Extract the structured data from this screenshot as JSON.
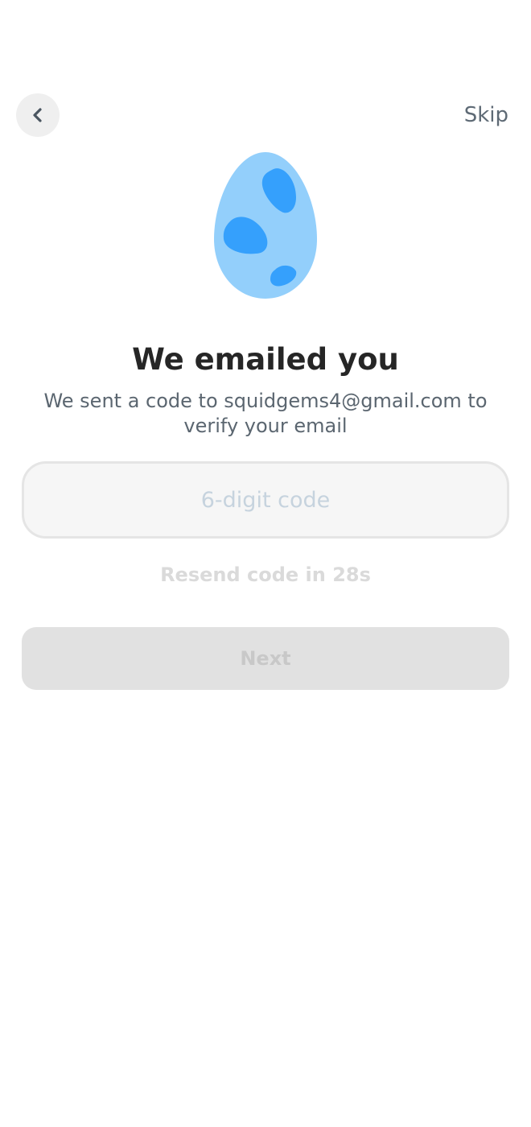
{
  "header": {
    "back_icon": "chevron-left-icon",
    "skip_label": "Skip"
  },
  "illustration": {
    "name": "egg",
    "colors": {
      "shell": "#93cffb",
      "spots": "#35a0fc"
    }
  },
  "main": {
    "title": "We emailed you",
    "subtitle": "We sent a code to squidgems4@gmail.com to verify your email",
    "code_input": {
      "value": "",
      "placeholder": "6-digit code"
    },
    "resend_text": "Resend code in 28s",
    "next_label": "Next"
  },
  "colors": {
    "title": "#262626",
    "subtitle": "#5b6670",
    "disabled_button_bg": "#e1e1e1",
    "disabled_text": "#c8c8c8",
    "input_bg": "#f6f6f6",
    "input_placeholder": "#c6d3de"
  }
}
